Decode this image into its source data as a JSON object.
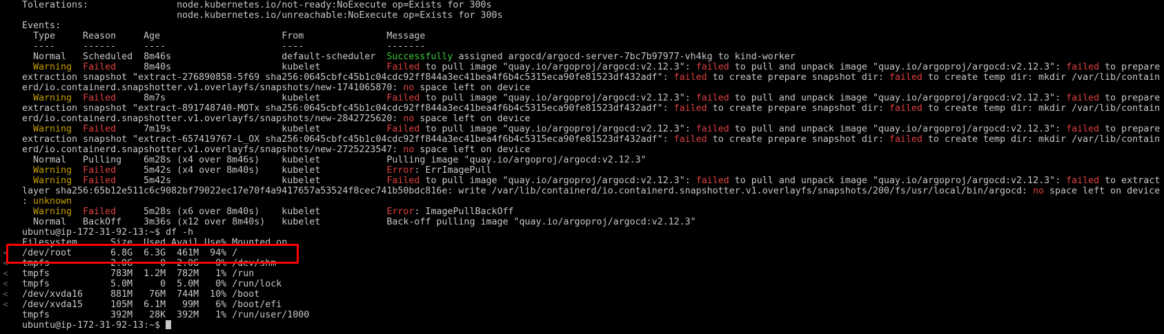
{
  "colors": {
    "background": "#000000",
    "text": "#c8c8c8",
    "warning": "#c8a000",
    "failed": "#e04040",
    "success": "#3cc83c",
    "highlight_box": "#ff0000"
  },
  "gutter_marks": [
    "<",
    "<",
    "<",
    "<",
    "<",
    "<"
  ],
  "lines": [
    [
      {
        "t": "Tolerations:                node.kubernetes.io/not-ready:NoExecute op=Exists for 300s"
      }
    ],
    [
      {
        "t": "                            node.kubernetes.io/unreachable:NoExecute op=Exists for 300s"
      }
    ],
    [
      {
        "t": "Events:"
      }
    ],
    [
      {
        "t": "  Type     Reason     Age                      From               Message"
      }
    ],
    [
      {
        "t": "  ----     ------     ----                     ----               -------"
      }
    ],
    [
      {
        "t": "  Normal   Scheduled  8m46s                    default-scheduler  "
      },
      {
        "t": "Successfully",
        "c": "success"
      },
      {
        "t": " assigned argocd/argocd-server-7bc7b97977-vh4kg to kind-worker"
      }
    ],
    [
      {
        "t": "  "
      },
      {
        "t": "Warning",
        "c": "warning"
      },
      {
        "t": "  "
      },
      {
        "t": "Failed",
        "c": "failed"
      },
      {
        "t": "     8m40s                    kubelet            "
      },
      {
        "t": "Failed",
        "c": "failed"
      },
      {
        "t": " to pull image \"quay.io/argoproj/argocd:v2.12.3\": "
      },
      {
        "t": "failed",
        "c": "failed"
      },
      {
        "t": " to pull and unpack image \"quay.io/argoproj/argocd:v2.12.3\": "
      },
      {
        "t": "failed",
        "c": "failed"
      },
      {
        "t": " to prepare"
      }
    ],
    [
      {
        "t": "extraction snapshot \"extract-276890858-5f69 sha256:0645cbfc45b1c04cdc92ff844a3ec41bea4f6b4c5315eca90fe81523df432adf\": "
      },
      {
        "t": "failed",
        "c": "failed"
      },
      {
        "t": " to create prepare snapshot dir: "
      },
      {
        "t": "failed",
        "c": "failed"
      },
      {
        "t": " to create temp dir: mkdir /var/lib/contain"
      }
    ],
    [
      {
        "t": "erd/io.containerd.snapshotter.v1.overlayfs/snapshots/new-1741065870: "
      },
      {
        "t": "no",
        "c": "failed"
      },
      {
        "t": " space left on device"
      }
    ],
    [
      {
        "t": "  "
      },
      {
        "t": "Warning",
        "c": "warning"
      },
      {
        "t": "  "
      },
      {
        "t": "Failed",
        "c": "failed"
      },
      {
        "t": "     8m7s                     kubelet            "
      },
      {
        "t": "Failed",
        "c": "failed"
      },
      {
        "t": " to pull image \"quay.io/argoproj/argocd:v2.12.3\": "
      },
      {
        "t": "failed",
        "c": "failed"
      },
      {
        "t": " to pull and unpack image \"quay.io/argoproj/argocd:v2.12.3\": "
      },
      {
        "t": "failed",
        "c": "failed"
      },
      {
        "t": " to prepare"
      }
    ],
    [
      {
        "t": "extraction snapshot \"extract-891748740-MOTx sha256:0645cbfc45b1c04cdc92ff844a3ec41bea4f6b4c5315eca90fe81523df432adf\": "
      },
      {
        "t": "failed",
        "c": "failed"
      },
      {
        "t": " to create prepare snapshot dir: "
      },
      {
        "t": "failed",
        "c": "failed"
      },
      {
        "t": " to create temp dir: mkdir /var/lib/contain"
      }
    ],
    [
      {
        "t": "erd/io.containerd.snapshotter.v1.overlayfs/snapshots/new-2842725620: "
      },
      {
        "t": "no",
        "c": "failed"
      },
      {
        "t": " space left on device"
      }
    ],
    [
      {
        "t": "  "
      },
      {
        "t": "Warning",
        "c": "warning"
      },
      {
        "t": "  "
      },
      {
        "t": "Failed",
        "c": "failed"
      },
      {
        "t": "     7m19s                    kubelet            "
      },
      {
        "t": "Failed",
        "c": "failed"
      },
      {
        "t": " to pull image \"quay.io/argoproj/argocd:v2.12.3\": "
      },
      {
        "t": "failed",
        "c": "failed"
      },
      {
        "t": " to pull and unpack image \"quay.io/argoproj/argocd:v2.12.3\": "
      },
      {
        "t": "failed",
        "c": "failed"
      },
      {
        "t": " to prepare"
      }
    ],
    [
      {
        "t": "extraction snapshot \"extract-657419767-L_OX sha256:0645cbfc45b1c04cdc92ff844a3ec41bea4f6b4c5315eca90fe81523df432adf\": "
      },
      {
        "t": "failed",
        "c": "failed"
      },
      {
        "t": " to create prepare snapshot dir: "
      },
      {
        "t": "failed",
        "c": "failed"
      },
      {
        "t": " to create temp dir: mkdir /var/lib/contain"
      }
    ],
    [
      {
        "t": "erd/io.containerd.snapshotter.v1.overlayfs/snapshots/new-2725223547: "
      },
      {
        "t": "no",
        "c": "failed"
      },
      {
        "t": " space left on device"
      }
    ],
    [
      {
        "t": "  Normal   Pulling    6m28s (x4 over 8m46s)    kubelet            Pulling image \"quay.io/argoproj/argocd:v2.12.3\""
      }
    ],
    [
      {
        "t": "  "
      },
      {
        "t": "Warning",
        "c": "warning"
      },
      {
        "t": "  "
      },
      {
        "t": "Failed",
        "c": "failed"
      },
      {
        "t": "     5m42s (x4 over 8m40s)    kubelet            "
      },
      {
        "t": "Error",
        "c": "failed"
      },
      {
        "t": ": ErrImagePull"
      }
    ],
    [
      {
        "t": "  "
      },
      {
        "t": "Warning",
        "c": "warning"
      },
      {
        "t": "  "
      },
      {
        "t": "Failed",
        "c": "failed"
      },
      {
        "t": "     5m42s                    kubelet            "
      },
      {
        "t": "Failed",
        "c": "failed"
      },
      {
        "t": " to pull image \"quay.io/argoproj/argocd:v2.12.3\": "
      },
      {
        "t": "failed",
        "c": "failed"
      },
      {
        "t": " to pull and unpack image \"quay.io/argoproj/argocd:v2.12.3\": "
      },
      {
        "t": "failed",
        "c": "failed"
      },
      {
        "t": " to extract"
      }
    ],
    [
      {
        "t": "layer sha256:65b12e511c6c9082bf79022ec17e70f4a9417657a53524f8cec741b50bdc816e: write /var/lib/containerd/io.containerd.snapshotter.v1.overlayfs/snapshots/200/fs/usr/local/bin/argocd: "
      },
      {
        "t": "no",
        "c": "failed"
      },
      {
        "t": " space left on device"
      }
    ],
    [
      {
        "t": ": "
      },
      {
        "t": "unknown",
        "c": "warning"
      }
    ],
    [
      {
        "t": "  "
      },
      {
        "t": "Warning",
        "c": "warning"
      },
      {
        "t": "  "
      },
      {
        "t": "Failed",
        "c": "failed"
      },
      {
        "t": "     5m28s (x6 over 8m40s)    kubelet            "
      },
      {
        "t": "Error",
        "c": "failed"
      },
      {
        "t": ": ImagePullBackOff"
      }
    ],
    [
      {
        "t": "  Normal   BackOff    3m36s (x12 over 8m40s)   kubelet            Back-off pulling image \"quay.io/argoproj/argocd:v2.12.3\""
      }
    ],
    [
      {
        "t": "ubuntu@ip-172-31-92-13:~$ df -h"
      }
    ],
    [
      {
        "t": "Filesystem      Size  Used Avail Use% Mounted on"
      }
    ],
    [
      {
        "t": "/dev/root       6.8G  6.3G  461M  94% /"
      }
    ],
    [
      {
        "t": "tmpfs           2.0G     0  2.0G   0% /dev/shm"
      }
    ],
    [
      {
        "t": "tmpfs           783M  1.2M  782M   1% /run"
      }
    ],
    [
      {
        "t": "tmpfs           5.0M     0  5.0M   0% /run/lock"
      }
    ],
    [
      {
        "t": "/dev/xvda16     881M   76M  744M  10% /boot"
      }
    ],
    [
      {
        "t": "/dev/xvda15     105M  6.1M   99M   6% /boot/efi"
      }
    ],
    [
      {
        "t": "tmpfs           392M   28K  392M   1% /run/user/1000"
      }
    ],
    [
      {
        "t": "ubuntu@ip-172-31-92-13:~$ "
      },
      {
        "cursor": true
      }
    ]
  ]
}
